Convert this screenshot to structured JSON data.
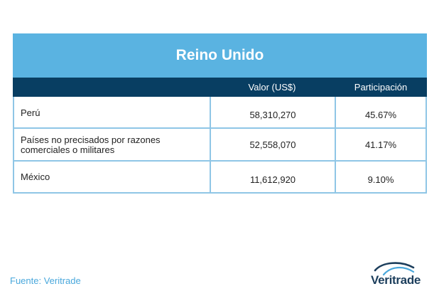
{
  "table": {
    "title": "Reino Unido",
    "headers": [
      "",
      "Valor (US$)",
      "Participación"
    ],
    "rows": [
      {
        "country": "Perú",
        "value": "58,310,270",
        "share": "45.67%"
      },
      {
        "country": "Países no precisados por razones comerciales o militares",
        "value": "52,558,070",
        "share": "41.17%"
      },
      {
        "country": "México",
        "value": "11,612,920",
        "share": "9.10%"
      }
    ]
  },
  "source": "Fuente: Veritrade",
  "logo": {
    "text": "Veritrade",
    "icon": "veritrade-swoosh-icon",
    "colors": {
      "navy": "#1c3e5c",
      "blue": "#4aa8dc"
    }
  },
  "colors": {
    "title_bg": "#5ab3e1",
    "header_bg": "#083e62",
    "border": "#8fc6e6",
    "source_text": "#4aa8dc"
  }
}
